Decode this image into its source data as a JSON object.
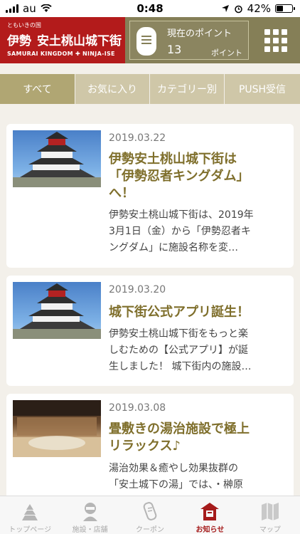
{
  "status_bar": {
    "carrier": "au",
    "time": "0:48",
    "battery": "42%",
    "battery_level": 0.42
  },
  "header": {
    "logo_small": "ともいきの国",
    "logo_main_left": "伊勢",
    "logo_main_right": "安土桃山城下街",
    "logo_sub": "SAMURAI KINGDOM ✚ NINJA-ISE",
    "points_label": "現在のポイント",
    "points_value": "13",
    "points_unit": "ポイント",
    "menu_icon": "grid-menu-icon"
  },
  "tabs": [
    {
      "label": "すべて",
      "active": true
    },
    {
      "label": "お気に入り",
      "active": false
    },
    {
      "label": "カテゴリー別",
      "active": false
    },
    {
      "label": "PUSH受信",
      "active": false
    }
  ],
  "news": [
    {
      "date": "2019.03.22",
      "title_lines": [
        "伊勢安土桃山城下街は",
        "「伊勢忍者キングダム」",
        "へ！"
      ],
      "body_lines": [
        "伊勢安土桃山城下街は、2019年",
        "3月1日（金）から「伊勢忍者キ",
        "ングダム」に施設名称を変…"
      ],
      "image": "castle"
    },
    {
      "date": "2019.03.20",
      "title_lines": [
        "城下街公式アプリ誕生！"
      ],
      "body_lines": [
        "伊勢安土桃山城下街をもっと楽",
        "しむための【公式アプリ】が誕",
        "生しました！ 城下街内の施設…"
      ],
      "image": "castle"
    },
    {
      "date": "2019.03.08",
      "title_lines": [
        "畳敷きの湯治施設で極上",
        "リラックス♪"
      ],
      "body_lines": [
        "湯治効果＆癒やし効果抜群の",
        "「安土城下の湯」では、・榊原"
      ],
      "image": "onsen"
    }
  ],
  "tabbar": [
    {
      "label": "トップページ",
      "icon": "castle-icon",
      "active": false
    },
    {
      "label": "施設・店舗",
      "icon": "ninja-icon",
      "active": false
    },
    {
      "label": "クーポン",
      "icon": "coupon-icon",
      "active": false
    },
    {
      "label": "お知らせ",
      "icon": "notice-icon",
      "active": true
    },
    {
      "label": "マップ",
      "icon": "map-icon",
      "active": false
    }
  ]
}
